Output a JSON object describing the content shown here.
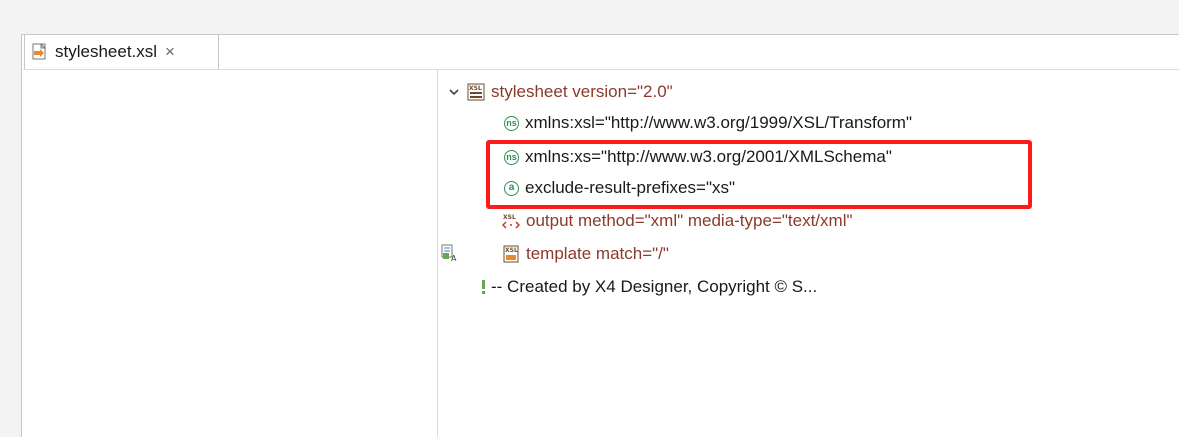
{
  "tab": {
    "label": "stylesheet.xsl",
    "close_glyph": "×",
    "icon": "xsl-file-icon"
  },
  "tree": {
    "root": {
      "label": "stylesheet version=\"2.0\"",
      "icon": "xsl-stylesheet-icon"
    },
    "attributes": [
      {
        "label": "xmlns:xsl=\"http://www.w3.org/1999/XSL/Transform\"",
        "icon": "namespace-icon",
        "icon_text": "ns"
      },
      {
        "label": "xmlns:xs=\"http://www.w3.org/2001/XMLSchema\"",
        "icon": "namespace-icon",
        "icon_text": "ns"
      },
      {
        "label": "exclude-result-prefixes=\"xs\"",
        "icon": "attribute-icon",
        "icon_text": "a"
      }
    ],
    "children": [
      {
        "label": "output method=\"xml\" media-type=\"text/xml\"",
        "icon": "xsl-output-icon"
      },
      {
        "label": "template match=\"/\"",
        "icon": "xsl-template-icon"
      }
    ],
    "comment": {
      "label": "-- Created by X4 Designer, Copyright © S...",
      "icon": "comment-icon"
    }
  },
  "colors": {
    "element_text": "#8b3a2b",
    "attribute_text": "#1a1a1a",
    "namespace_icon": "#2e8b57",
    "highlight": "#ff1a1a"
  }
}
